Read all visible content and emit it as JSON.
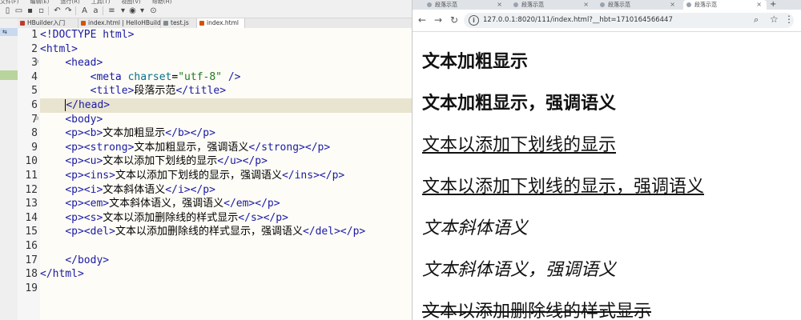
{
  "editor": {
    "menu": [
      "文件(F)",
      "编辑(E)",
      "运行(R)",
      "工具(T)",
      "视图(V)",
      "帮助(H)"
    ],
    "tabs": [
      "HBuilder入门",
      "index.html | HelloHBuilder",
      "test.js",
      "index.html"
    ],
    "gutter_mark": "⇆",
    "lines": [
      {
        "n": "1",
        "segs": [
          {
            "c": "t-blue",
            "t": "<!DOCTYPE html>"
          }
        ]
      },
      {
        "n": "2",
        "segs": [
          {
            "c": "t-blue",
            "t": "<html>"
          }
        ]
      },
      {
        "n": "3",
        "fold": true,
        "segs": [
          {
            "c": "",
            "t": "    "
          },
          {
            "c": "t-blue",
            "t": "<head>"
          }
        ]
      },
      {
        "n": "4",
        "segs": [
          {
            "c": "",
            "t": "        "
          },
          {
            "c": "t-blue",
            "t": "<meta "
          },
          {
            "c": "t-attr",
            "t": "charset"
          },
          {
            "c": "",
            "t": "="
          },
          {
            "c": "t-str",
            "t": "\"utf-8\""
          },
          {
            "c": "t-blue",
            "t": " />"
          }
        ]
      },
      {
        "n": "5",
        "segs": [
          {
            "c": "",
            "t": "        "
          },
          {
            "c": "t-blue",
            "t": "<title>"
          },
          {
            "c": "",
            "t": "段落示范"
          },
          {
            "c": "t-blue",
            "t": "</title>"
          }
        ]
      },
      {
        "n": "6",
        "hl": true,
        "segs": [
          {
            "c": "",
            "t": "    "
          },
          {
            "c": "t-blue caret",
            "t": "</head>"
          }
        ]
      },
      {
        "n": "7",
        "fold": true,
        "segs": [
          {
            "c": "",
            "t": "    "
          },
          {
            "c": "t-blue",
            "t": "<body>"
          }
        ]
      },
      {
        "n": "8",
        "segs": [
          {
            "c": "",
            "t": "    "
          },
          {
            "c": "t-blue",
            "t": "<p><b>"
          },
          {
            "c": "",
            "t": "文本加粗显示"
          },
          {
            "c": "t-blue",
            "t": "</b></p>"
          }
        ]
      },
      {
        "n": "9",
        "segs": [
          {
            "c": "",
            "t": "    "
          },
          {
            "c": "t-blue",
            "t": "<p><strong>"
          },
          {
            "c": "",
            "t": "文本加粗显示，强调语义"
          },
          {
            "c": "t-blue",
            "t": "</strong></p>"
          }
        ]
      },
      {
        "n": "10",
        "segs": [
          {
            "c": "",
            "t": "    "
          },
          {
            "c": "t-blue",
            "t": "<p><u>"
          },
          {
            "c": "",
            "t": "文本以添加下划线的显示"
          },
          {
            "c": "t-blue",
            "t": "</u></p>"
          }
        ]
      },
      {
        "n": "11",
        "segs": [
          {
            "c": "",
            "t": "    "
          },
          {
            "c": "t-blue",
            "t": "<p><ins>"
          },
          {
            "c": "",
            "t": "文本以添加下划线的显示，强调语义"
          },
          {
            "c": "t-blue",
            "t": "</ins></p>"
          }
        ]
      },
      {
        "n": "12",
        "segs": [
          {
            "c": "",
            "t": "    "
          },
          {
            "c": "t-blue",
            "t": "<p><i>"
          },
          {
            "c": "",
            "t": "文本斜体语义"
          },
          {
            "c": "t-blue",
            "t": "</i></p>"
          }
        ]
      },
      {
        "n": "13",
        "segs": [
          {
            "c": "",
            "t": "    "
          },
          {
            "c": "t-blue",
            "t": "<p><em>"
          },
          {
            "c": "",
            "t": "文本斜体语义，强调语义"
          },
          {
            "c": "t-blue",
            "t": "</em></p>"
          }
        ]
      },
      {
        "n": "14",
        "segs": [
          {
            "c": "",
            "t": "    "
          },
          {
            "c": "t-blue",
            "t": "<p><s>"
          },
          {
            "c": "",
            "t": "文本以添加删除线的样式显示"
          },
          {
            "c": "t-blue",
            "t": "</s></p>"
          }
        ]
      },
      {
        "n": "15",
        "segs": [
          {
            "c": "",
            "t": "    "
          },
          {
            "c": "t-blue",
            "t": "<p><del>"
          },
          {
            "c": "",
            "t": "文本以添加删除线的样式显示，强调语义"
          },
          {
            "c": "t-blue",
            "t": "</del></p>"
          }
        ]
      },
      {
        "n": "16",
        "segs": []
      },
      {
        "n": "17",
        "segs": [
          {
            "c": "",
            "t": "    "
          },
          {
            "c": "t-blue",
            "t": "</body>"
          }
        ]
      },
      {
        "n": "18",
        "segs": [
          {
            "c": "t-blue",
            "t": "</html>"
          }
        ]
      },
      {
        "n": "19",
        "segs": []
      }
    ]
  },
  "browser": {
    "tabs": [
      "段落示范",
      "段落示范",
      "段落示范",
      "段落示范"
    ],
    "active_tab": 3,
    "new_tab": "+",
    "url": "127.0.0.1:8020/111/index.html?__hbt=1710164566447",
    "nav_icons": {
      "back": "back-arrow-icon",
      "forward": "forward-arrow-icon",
      "reload": "reload-icon"
    },
    "paragraphs": [
      {
        "text": "文本加粗显示",
        "style": "p-bold"
      },
      {
        "text": "文本加粗显示，强调语义",
        "style": "p-bold"
      },
      {
        "text": "文本以添加下划线的显示",
        "style": "p-u"
      },
      {
        "text": "文本以添加下划线的显示，强调语义",
        "style": "p-u"
      },
      {
        "text": "文本斜体语义",
        "style": "p-i"
      },
      {
        "text": "文本斜体语义，强调语义",
        "style": "p-i"
      },
      {
        "text": "文本以添加删除线的样式显示",
        "style": "p-s"
      }
    ]
  },
  "colors": {
    "tag": "#1a1aa6",
    "attr": "#0a6e8a",
    "string": "#1f7a1f",
    "current_line": "#e9e4cf"
  }
}
